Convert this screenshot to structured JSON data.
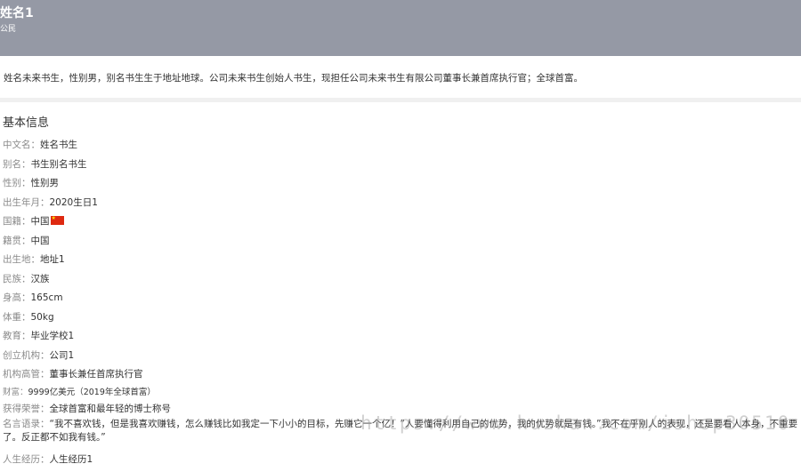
{
  "header": {
    "name": "姓名1",
    "subtitle": "公民"
  },
  "intro": "姓名未来书生，性别男，别名书生生于地址地球。公司未来书生创始人书生，现担任公司未来书生有限公司董事长兼首席执行官；全球首富。",
  "section_title": "基本信息",
  "info": [
    {
      "label": "中文名：",
      "value": "姓名书生"
    },
    {
      "label": "别名：",
      "value": "书生别名书生"
    },
    {
      "label": "性别：",
      "value": "性别男"
    },
    {
      "label": "出生年月：",
      "value": "2020生日1"
    },
    {
      "label": "国籍：",
      "value": "中国",
      "flag": "china-flag-icon"
    },
    {
      "label": "籍贯：",
      "value": "中国"
    },
    {
      "label": "出生地：",
      "value": "地址1"
    },
    {
      "label": "民族：",
      "value": "汉族"
    },
    {
      "label": "身高：",
      "value": "165cm"
    },
    {
      "label": "体重：",
      "value": "50kg"
    },
    {
      "label": "教育：",
      "value": "毕业学校1"
    },
    {
      "label": "创立机构：",
      "value": "公司1"
    },
    {
      "label": "机构高管：",
      "value": "董事长兼任首席执行官"
    },
    {
      "label": "财富：",
      "value": "9999亿美元（2019年全球首富）"
    },
    {
      "label": "获得荣誉：",
      "value": "全球首富和最年轻的博士称号"
    }
  ],
  "motto": {
    "label": "名言语录：",
    "value": "“我不喜欢钱，但是我喜欢赚钱，怎么赚钱比如我定一下小小的目标，先赚它一个亿！”人要懂得利用自己的优势，我的优势就是有钱。”我不在乎别人的表现，还是要看人本身，不重要了。反正都不如我有钱。”"
  },
  "life": {
    "label": "人生经历：",
    "value": "人生经历1"
  },
  "watermark": "https://www.huzhan.com/ishop30510"
}
